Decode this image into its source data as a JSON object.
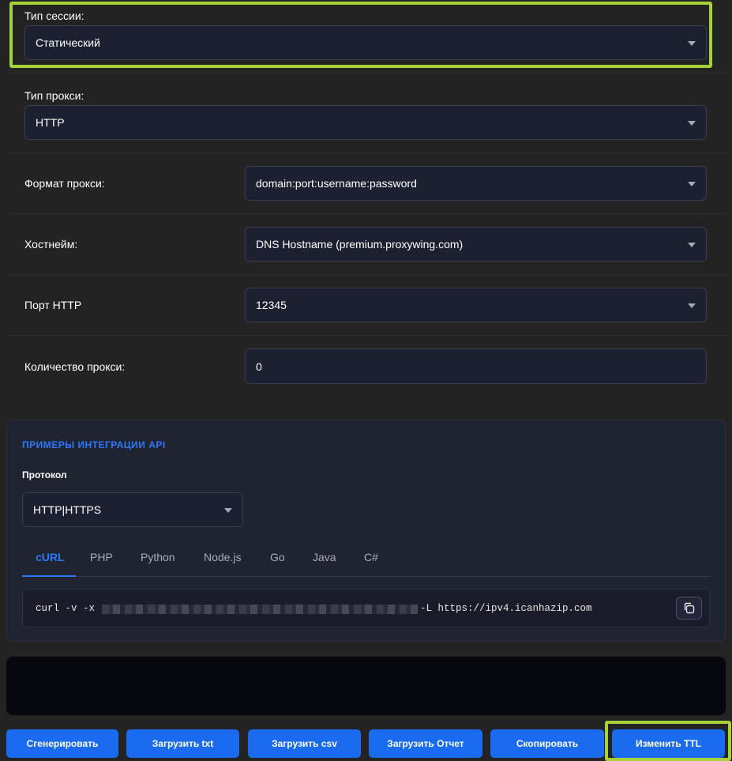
{
  "session": {
    "label": "Тип сессии:",
    "value": "Статический"
  },
  "proxy_type": {
    "label": "Тип прокси:",
    "value": "HTTP"
  },
  "proxy_format": {
    "label": "Формат прокси:",
    "value": "domain:port:username:password"
  },
  "hostname": {
    "label": "Хостнейм:",
    "value": "DNS Hostname (premium.proxywing.com)"
  },
  "port": {
    "label": "Порт HTTP",
    "value": "12345"
  },
  "count": {
    "label": "Количество прокси:",
    "value": "0"
  },
  "api": {
    "title": "ПРИМЕРЫ ИНТЕГРАЦИИ API",
    "protocol_label": "Протокол",
    "protocol_value": "HTTP|HTTPS",
    "tabs": [
      "cURL",
      "PHP",
      "Python",
      "Node.js",
      "Go",
      "Java",
      "C#"
    ],
    "active_tab": "cURL",
    "code_prefix": "curl -v -x",
    "code_suffix": "-L https://ipv4.icanhazip.com"
  },
  "buttons": {
    "generate": "Сгенерировать",
    "download_txt": "Загрузить txt",
    "download_csv": "Загрузить csv",
    "download_report": "Загрузить Отчет",
    "copy": "Скопировать",
    "change_ttl": "Изменить TTL"
  },
  "colors": {
    "accent": "#2a78ff",
    "button": "#1a6bf0",
    "highlight": "#a7d13a",
    "background": "#232323"
  }
}
